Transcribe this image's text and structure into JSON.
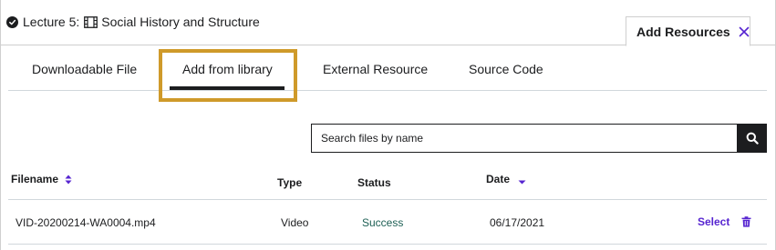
{
  "header": {
    "lecture_label": "Lecture 5:",
    "lecture_title": "Social History and Structure",
    "add_resources_tab": "Add Resources"
  },
  "subtabs": [
    {
      "label": "Downloadable File",
      "active": false
    },
    {
      "label": "Add from library",
      "active": true
    },
    {
      "label": "External Resource",
      "active": false
    },
    {
      "label": "Source Code",
      "active": false
    }
  ],
  "search": {
    "placeholder": "Search files by name",
    "value": ""
  },
  "table": {
    "columns": {
      "filename": "Filename",
      "type": "Type",
      "status": "Status",
      "date": "Date"
    },
    "rows": [
      {
        "filename": "VID-20200214-WA0004.mp4",
        "type": "Video",
        "status": "Success",
        "date": "06/17/2021",
        "action": "Select"
      }
    ]
  },
  "colors": {
    "accent_purple": "#5624d0",
    "highlight_gold": "#cf9a2a",
    "status_green": "#1e6055",
    "text_dark": "#1c1d1f"
  },
  "icons": {
    "lecture_status": "check-circle-icon",
    "lecture_type": "film-icon",
    "close": "close-icon",
    "search": "search-icon",
    "filename_sort": "sort-up-down-icon",
    "date_sort": "sort-down-icon",
    "delete": "trash-icon"
  }
}
